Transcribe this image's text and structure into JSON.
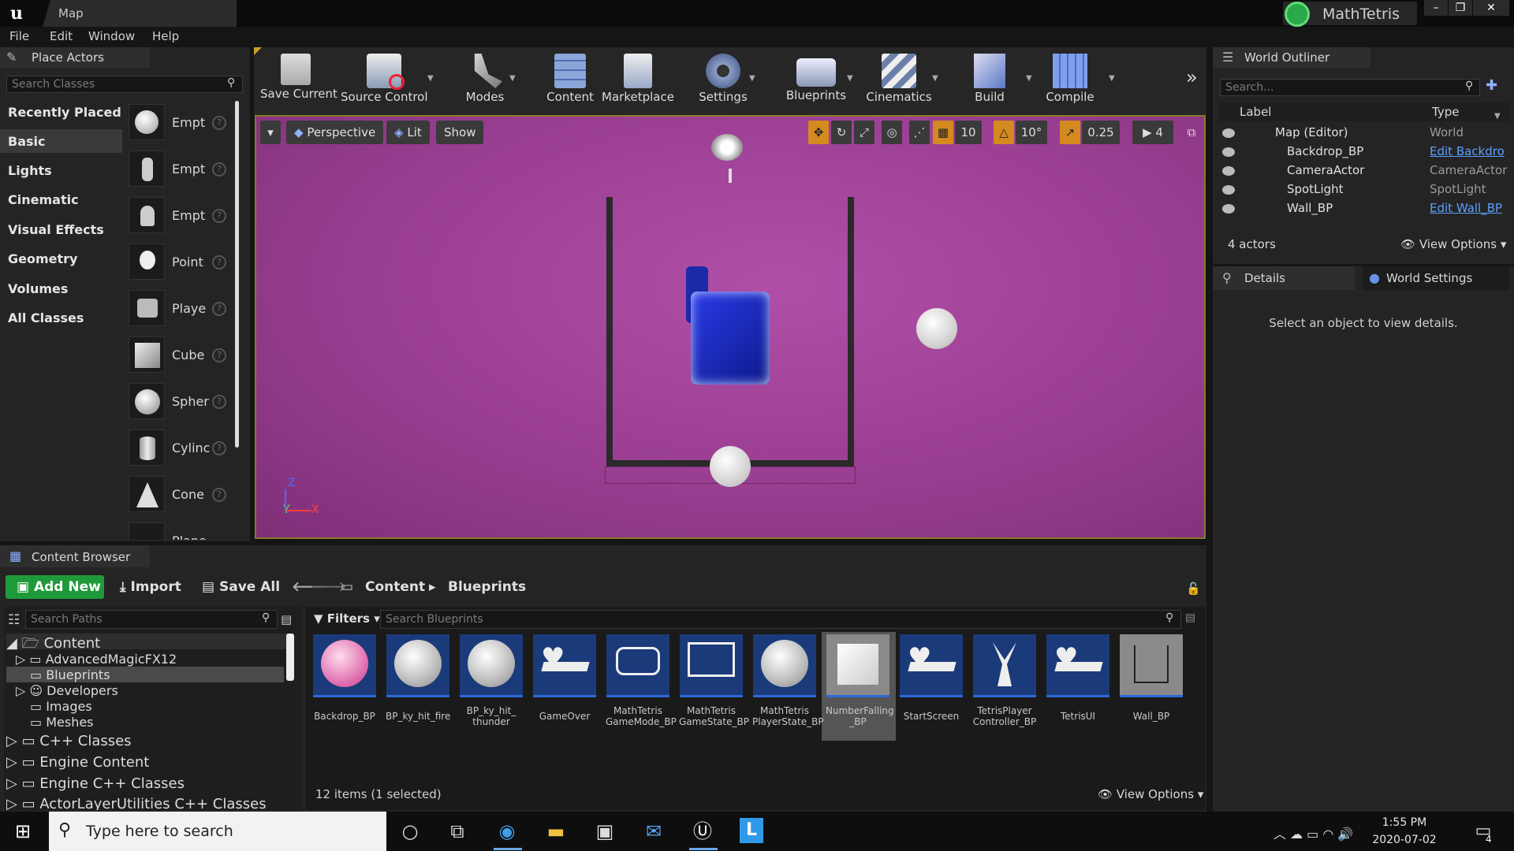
{
  "window": {
    "tab_title": "Map",
    "project_name": "MathTetris"
  },
  "menu": [
    "File",
    "Edit",
    "Window",
    "Help"
  ],
  "place_actors": {
    "tab_title": "Place Actors",
    "search_placeholder": "Search Classes",
    "categories": [
      "Recently Placed",
      "Basic",
      "Lights",
      "Cinematic",
      "Visual Effects",
      "Geometry",
      "Volumes",
      "All Classes"
    ],
    "selected_category": "Basic",
    "items": [
      "Empt",
      "Empt",
      "Empt",
      "Point",
      "Playe",
      "Cube",
      "Spher",
      "Cylinc",
      "Cone",
      "Plane"
    ]
  },
  "toolbar": {
    "buttons": [
      "Save Current",
      "Source Control",
      "Modes",
      "Content",
      "Marketplace",
      "Settings",
      "Blueprints",
      "Cinematics",
      "Build",
      "Compile"
    ]
  },
  "viewport": {
    "perspective_label": "Perspective",
    "lit_label": "Lit",
    "show_label": "Show",
    "grid_snap": "10",
    "rotation_snap": "10°",
    "scale_snap": "0.25",
    "camera_speed": "4"
  },
  "outliner": {
    "tab_title": "World Outliner",
    "search_placeholder": "Search...",
    "col_label": "Label",
    "col_type": "Type",
    "rows": [
      {
        "label": "Map (Editor)",
        "type": "World",
        "link": false
      },
      {
        "label": "Backdrop_BP",
        "type": "Edit Backdro",
        "link": true
      },
      {
        "label": "CameraActor",
        "type": "CameraActor",
        "link": false
      },
      {
        "label": "SpotLight",
        "type": "SpotLight",
        "link": false
      },
      {
        "label": "Wall_BP",
        "type": "Edit Wall_BP",
        "link": true
      }
    ],
    "actor_count": "4 actors",
    "view_options": "View Options"
  },
  "details": {
    "tab_title": "Details",
    "tab2_title": "World Settings",
    "empty_message": "Select an object to view details."
  },
  "content_browser": {
    "tab_title": "Content Browser",
    "add_new": "Add New",
    "import": "Import",
    "save_all": "Save All",
    "breadcrumb": [
      "Content",
      "Blueprints"
    ],
    "search_paths_placeholder": "Search Paths",
    "filters_label": "Filters",
    "search_placeholder": "Search Blueprints",
    "tree": [
      "Content",
      "AdvancedMagicFX12",
      "Blueprints",
      "Developers",
      "Images",
      "Meshes",
      "C++ Classes",
      "Engine Content",
      "Engine C++ Classes",
      "ActorLayerUtilities C++ Classes"
    ],
    "assets": [
      "Backdrop_BP",
      "BP_ky_hit_fire",
      "BP_ky_hit_\nthunder",
      "GameOver",
      "MathTetris\nGameMode_BP",
      "MathTetris\nGameState_BP",
      "MathTetris\nPlayerState_BP",
      "NumberFalling\n_BP",
      "StartScreen",
      "TetrisPlayer\nController_BP",
      "TetrisUI",
      "Wall_BP"
    ],
    "selected_asset": "NumberFalling\n_BP",
    "status": "12 items (1 selected)",
    "view_options": "View Options"
  },
  "taskbar": {
    "search_placeholder": "Type here to search",
    "time": "1:55 PM",
    "date": "2020-07-02",
    "notification_count": "4"
  }
}
